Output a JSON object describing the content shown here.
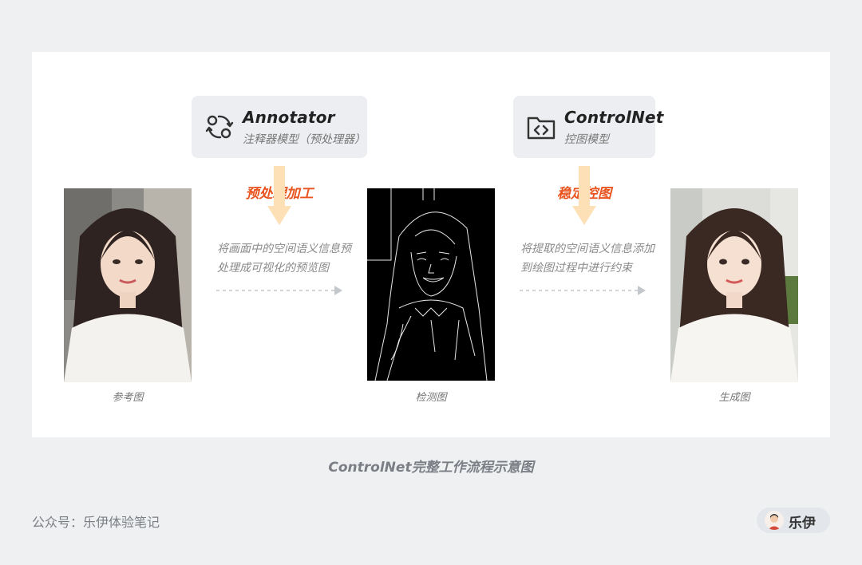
{
  "annotator": {
    "icon": "annotator-cycle-icon",
    "title": "Annotator",
    "subtitle": "注释器模型（预处理器）"
  },
  "controlnet": {
    "icon": "code-folder-icon",
    "title": "ControlNet",
    "subtitle": "控图模型"
  },
  "step1": {
    "title": "预处理加工",
    "desc_line1": "将画面中的空间语义信息预",
    "desc_line2": "处理成可视化的预览图"
  },
  "step2": {
    "title": "稳定控图",
    "desc_line1": "将提取的空间语义信息添加",
    "desc_line2": "到绘图过程中进行约束"
  },
  "images": {
    "reference_label": "参考图",
    "detection_label": "检测图",
    "generated_label": "生成图"
  },
  "caption": "ControlNet完整工作流程示意图",
  "footer": {
    "account": "公众号：乐伊体验笔记",
    "author": "乐伊"
  },
  "colors": {
    "accent": "#e8531e",
    "arrow_fill": "#fde0b5",
    "panel_bg": "#ffffff",
    "page_bg": "#eef0f2"
  }
}
